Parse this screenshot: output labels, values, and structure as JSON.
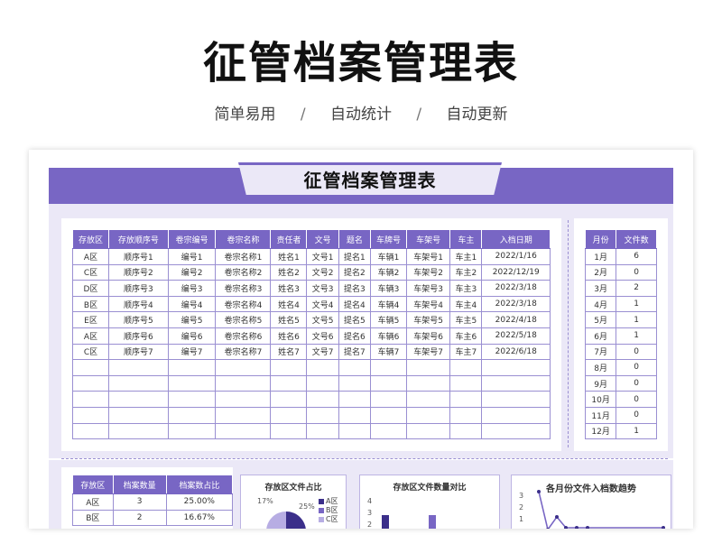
{
  "page": {
    "headline": "征管档案管理表",
    "tags": [
      "简单易用",
      "自动统计",
      "自动更新"
    ],
    "separator": "/"
  },
  "sheet": {
    "title": "征管档案管理表"
  },
  "main_table": {
    "headers": [
      "存放区",
      "存放顺序号",
      "卷宗编号",
      "卷宗名称",
      "责任者",
      "文号",
      "题名",
      "车牌号",
      "车架号",
      "车主",
      "入档日期"
    ],
    "rows": [
      [
        "A区",
        "顺序号1",
        "编号1",
        "卷宗名称1",
        "姓名1",
        "文号1",
        "提名1",
        "车辆1",
        "车架号1",
        "车主1",
        "2022/1/16"
      ],
      [
        "C区",
        "顺序号2",
        "编号2",
        "卷宗名称2",
        "姓名2",
        "文号2",
        "提名2",
        "车辆2",
        "车架号2",
        "车主2",
        "2022/12/19"
      ],
      [
        "D区",
        "顺序号3",
        "编号3",
        "卷宗名称3",
        "姓名3",
        "文号3",
        "提名3",
        "车辆3",
        "车架号3",
        "车主3",
        "2022/3/18"
      ],
      [
        "B区",
        "顺序号4",
        "编号4",
        "卷宗名称4",
        "姓名4",
        "文号4",
        "提名4",
        "车辆4",
        "车架号4",
        "车主4",
        "2022/3/18"
      ],
      [
        "E区",
        "顺序号5",
        "编号5",
        "卷宗名称5",
        "姓名5",
        "文号5",
        "提名5",
        "车辆5",
        "车架号5",
        "车主5",
        "2022/4/18"
      ],
      [
        "A区",
        "顺序号6",
        "编号6",
        "卷宗名称6",
        "姓名6",
        "文号6",
        "提名6",
        "车辆6",
        "车架号6",
        "车主6",
        "2022/5/18"
      ],
      [
        "C区",
        "顺序号7",
        "编号7",
        "卷宗名称7",
        "姓名7",
        "文号7",
        "提名7",
        "车辆7",
        "车架号7",
        "车主7",
        "2022/6/18"
      ],
      [
        "",
        "",
        "",
        "",
        "",
        "",
        "",
        "",
        "",
        "",
        ""
      ],
      [
        "",
        "",
        "",
        "",
        "",
        "",
        "",
        "",
        "",
        "",
        ""
      ],
      [
        "",
        "",
        "",
        "",
        "",
        "",
        "",
        "",
        "",
        "",
        ""
      ],
      [
        "",
        "",
        "",
        "",
        "",
        "",
        "",
        "",
        "",
        "",
        ""
      ],
      [
        "",
        "",
        "",
        "",
        "",
        "",
        "",
        "",
        "",
        "",
        ""
      ]
    ]
  },
  "month_table": {
    "headers": [
      "月份",
      "文件数"
    ],
    "rows": [
      [
        "1月",
        "6"
      ],
      [
        "2月",
        "0"
      ],
      [
        "3月",
        "2"
      ],
      [
        "4月",
        "1"
      ],
      [
        "5月",
        "1"
      ],
      [
        "6月",
        "1"
      ],
      [
        "7月",
        "0"
      ],
      [
        "8月",
        "0"
      ],
      [
        "9月",
        "0"
      ],
      [
        "10月",
        "0"
      ],
      [
        "11月",
        "0"
      ],
      [
        "12月",
        "1"
      ]
    ]
  },
  "zone_table": {
    "headers": [
      "存放区",
      "档案数量",
      "档案数占比"
    ],
    "rows": [
      [
        "A区",
        "3",
        "25.00%"
      ],
      [
        "B区",
        "2",
        "16.67%"
      ]
    ]
  },
  "pie_card": {
    "title": "存放区文件占比",
    "labels": [
      "17%",
      "25%"
    ],
    "legend": [
      "A区",
      "B区",
      "C区"
    ],
    "colors": [
      "#3b2f8a",
      "#7866c4",
      "#b7ade3"
    ]
  },
  "bar_card": {
    "title": "存放区文件数量对比",
    "ticks": [
      "4",
      "3",
      "2"
    ]
  },
  "line_card": {
    "title": "各月份文件入档数趋势",
    "ticks": [
      "3",
      "2",
      "1"
    ]
  },
  "colors": {
    "accent": "#7866c4",
    "lavender": "#ebe8f7",
    "dark_accent": "#3b2f8a"
  }
}
